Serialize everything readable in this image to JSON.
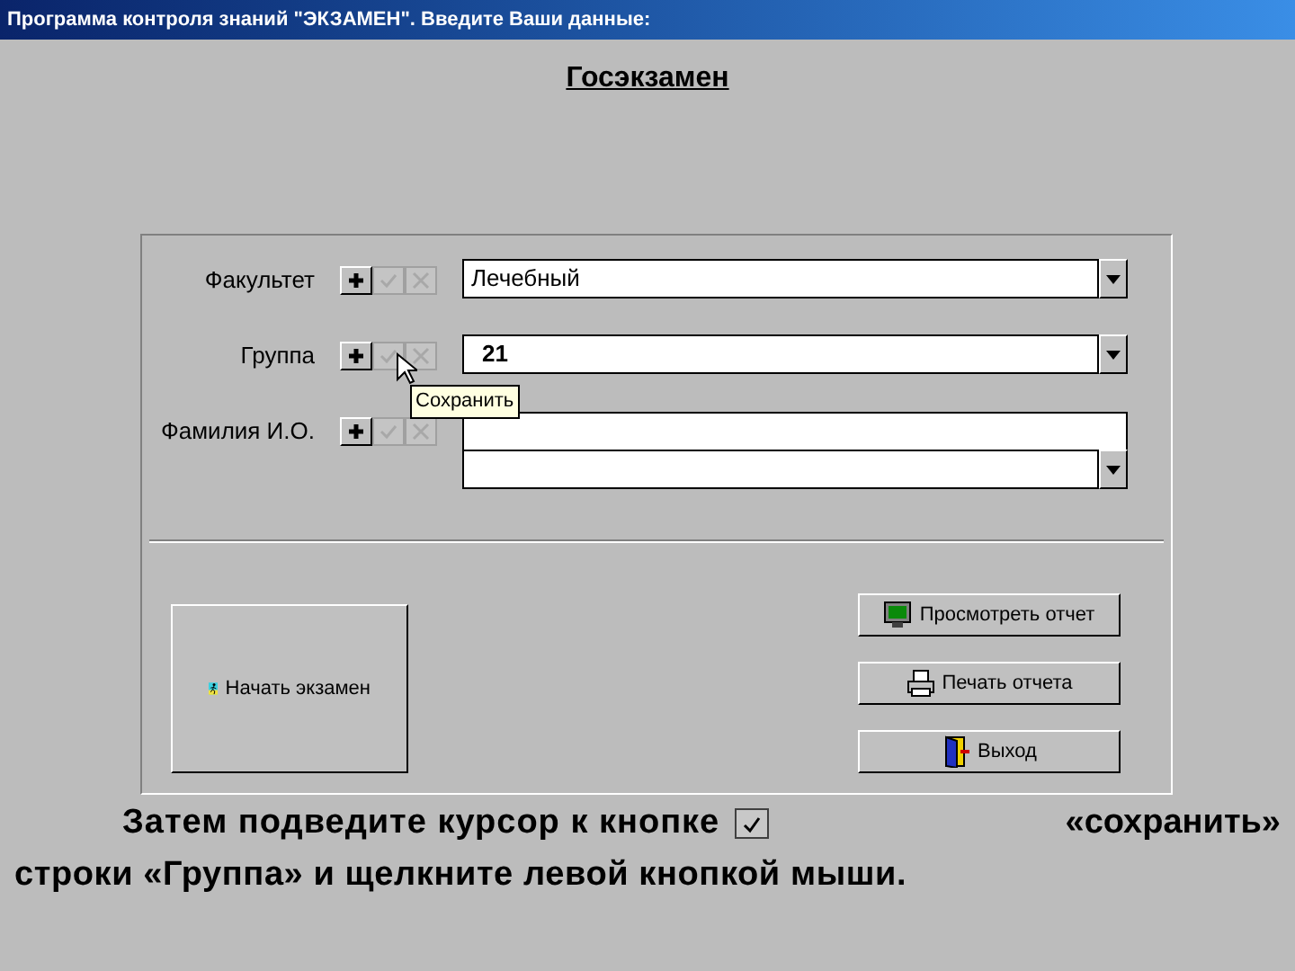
{
  "window": {
    "title": "Программа контроля знаний \"ЭКЗАМЕН\". Введите Ваши данные:"
  },
  "heading": "Госэкзамен",
  "rows": [
    {
      "label": "Факультет",
      "buttons": [
        {
          "kind": "add",
          "disabled": false
        },
        {
          "kind": "save",
          "disabled": true
        },
        {
          "kind": "cancel",
          "disabled": true
        }
      ],
      "fields": [
        {
          "kind": "combo",
          "value": "Лечебный",
          "bold": false
        }
      ]
    },
    {
      "label": "Группа",
      "buttons": [
        {
          "kind": "add",
          "disabled": false
        },
        {
          "kind": "save",
          "disabled": true
        },
        {
          "kind": "cancel",
          "disabled": true
        }
      ],
      "fields": [
        {
          "kind": "combo",
          "value": "21",
          "bold": true
        }
      ]
    },
    {
      "label": "Фамилия И.О.",
      "buttons": [
        {
          "kind": "add",
          "disabled": false
        },
        {
          "kind": "save",
          "disabled": true
        },
        {
          "kind": "cancel",
          "disabled": true
        }
      ],
      "fields": [
        {
          "kind": "text"
        },
        {
          "kind": "combo"
        }
      ]
    }
  ],
  "tooltip": "Сохранить",
  "start_button": "Начать экзамен",
  "actions": [
    {
      "kind": "view",
      "label": "Просмотреть отчет"
    },
    {
      "kind": "print",
      "label": "Печать отчета"
    },
    {
      "kind": "exit",
      "label": "Выход"
    }
  ],
  "caption": {
    "line1": "Затем подведите курсор к кнопке",
    "line1_end": "«сохранить»",
    "line2": "строки «Группа» и щелкните левой кнопкой мыши."
  }
}
